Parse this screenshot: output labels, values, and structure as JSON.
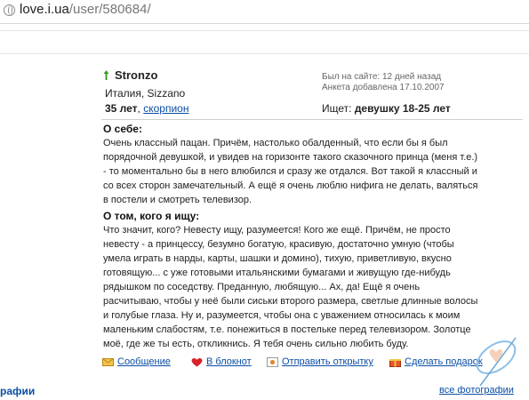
{
  "browser": {
    "host": "love.i.ua",
    "path": "/user/580684/"
  },
  "profile": {
    "name": "Stronzo",
    "location": "Италия, Sizzano",
    "age": "35 лет",
    "zodiac": "скорпион",
    "last_seen": "Был на сайте: 12 дней назад",
    "added": "Анкета добавлена 17.10.2007",
    "seek_label": "Ищет:",
    "seek_value": "девушку 18-25 лет"
  },
  "about": {
    "heading": "О себе:",
    "lines": [
      "Очень классный пацан. Причём, настолько обалденный, что если бы я был",
      "порядочной девушкой, и увидев на горизонте такого сказочного принца (меня т.е.)",
      "- то моментально бы в него влюбился и сразу же отдался. Вот такой я классный и",
      "со всех сторон замечательный. А ещё я очень люблю нифига не делать, валяться",
      "в постели и смотреть телевизор."
    ]
  },
  "seeking": {
    "heading": "О том, кого я ищу:",
    "lines": [
      "Что значит, кого? Невесту ищу, разумеется! Кого же ещё. Причём, не просто",
      "невесту - а принцессу, безумно богатую, красивую, достаточно умную (чтобы",
      "умела играть в нарды, карты, шашки и домино), тихую, приветливую, вкусно",
      "готовящую... с уже готовыми итальянскими бумагами и живущую где-нибудь",
      "рядышком по соседству. Преданную, любящую... Ах, да! Ещё я очень",
      "расчитываю, чтобы у неё были сиськи второго размера, светлые длинные волосы",
      "и голубые глаза. Ну и, разумеется, чтобы она с уважением относилась к моим",
      "маленьким слабостям, т.е. понежиться в постельке перед телевизором. Золотце",
      "моё, где же ты есть, откликнись. Я тебя очень сильно любить буду."
    ]
  },
  "actions": {
    "message": "Сообщение",
    "notebook": "В блокнот",
    "postcard": "Отправить открытку",
    "gift": "Сделать подарок"
  },
  "footer": {
    "left_fragment": "рафии",
    "all_photos": "все фотографии"
  },
  "colors": {
    "link": "#0a4ea3",
    "meta_text": "#666666",
    "divider": "#cfcfcf"
  }
}
